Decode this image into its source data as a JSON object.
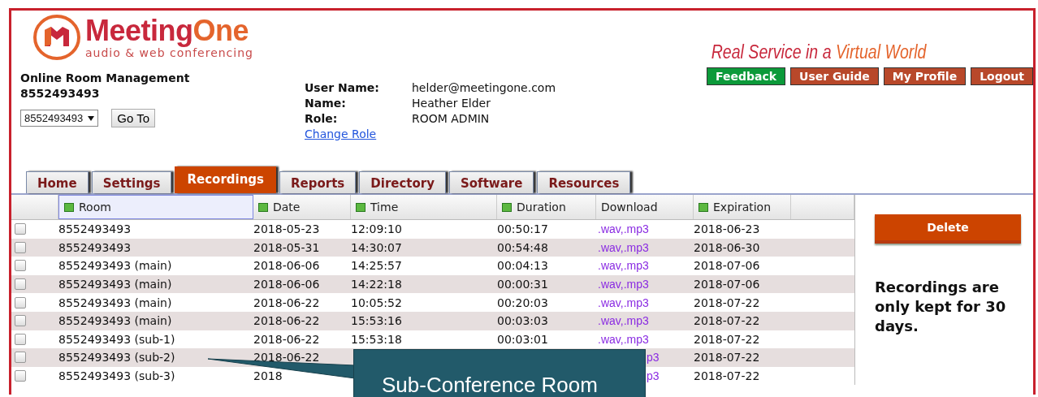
{
  "logo": {
    "word_1": "Meeting",
    "word_2": "One",
    "tagline": "audio & web conferencing"
  },
  "account": {
    "title": "Online Room Management",
    "number": "8552493493",
    "room_select": "8552493493",
    "go_button": "Go To"
  },
  "user": {
    "fields": [
      {
        "label": "User Name:",
        "value": "helder@meetingone.com"
      },
      {
        "label": "Name:",
        "value": "Heather Elder"
      },
      {
        "label": "Role:",
        "value": "ROOM ADMIN"
      }
    ],
    "change_role_link": "Change Role"
  },
  "slogan": {
    "part_1": "Real Service in a",
    "part_2": "Virtual World"
  },
  "top_buttons": [
    {
      "label": "Feedback",
      "color": "#0c9a3a"
    },
    {
      "label": "User Guide",
      "color": "#b8482a"
    },
    {
      "label": "My Profile",
      "color": "#b8482a"
    },
    {
      "label": "Logout",
      "color": "#b8482a"
    }
  ],
  "tabs": [
    {
      "label": "Home",
      "selected": false
    },
    {
      "label": "Settings",
      "selected": false
    },
    {
      "label": "Recordings",
      "selected": true
    },
    {
      "label": "Reports",
      "selected": false
    },
    {
      "label": "Directory",
      "selected": false
    },
    {
      "label": "Software",
      "selected": false
    },
    {
      "label": "Resources",
      "selected": false
    }
  ],
  "table": {
    "columns": [
      {
        "label": "Room",
        "sortable": true,
        "selected": true
      },
      {
        "label": "Date",
        "sortable": true,
        "selected": false
      },
      {
        "label": "Time",
        "sortable": true,
        "selected": false
      },
      {
        "label": "Duration",
        "sortable": true,
        "selected": false
      },
      {
        "label": "Download",
        "sortable": false,
        "selected": false
      },
      {
        "label": "Expiration",
        "sortable": true,
        "selected": false
      }
    ],
    "rows": [
      {
        "checked": false,
        "room": "8552493493",
        "date": "2018-05-23",
        "time": "12:09:10",
        "duration": "00:50:17",
        "download": ".wav,.mp3",
        "expiration": "2018-06-23"
      },
      {
        "checked": false,
        "room": "8552493493",
        "date": "2018-05-31",
        "time": "14:30:07",
        "duration": "00:54:48",
        "download": ".wav,.mp3",
        "expiration": "2018-06-30"
      },
      {
        "checked": false,
        "room": "8552493493 (main)",
        "date": "2018-06-06",
        "time": "14:25:57",
        "duration": "00:04:13",
        "download": ".wav,.mp3",
        "expiration": "2018-07-06"
      },
      {
        "checked": false,
        "room": "8552493493 (main)",
        "date": "2018-06-06",
        "time": "14:22:18",
        "duration": "00:00:31",
        "download": ".wav,.mp3",
        "expiration": "2018-07-06"
      },
      {
        "checked": false,
        "room": "8552493493 (main)",
        "date": "2018-06-22",
        "time": "10:05:52",
        "duration": "00:20:03",
        "download": ".wav,.mp3",
        "expiration": "2018-07-22"
      },
      {
        "checked": false,
        "room": "8552493493 (main)",
        "date": "2018-06-22",
        "time": "15:53:16",
        "duration": "00:03:03",
        "download": ".wav,.mp3",
        "expiration": "2018-07-22"
      },
      {
        "checked": false,
        "room": "8552493493 (sub-1)",
        "date": "2018-06-22",
        "time": "15:53:18",
        "duration": "00:03:01",
        "download": ".wav,.mp3",
        "expiration": "2018-07-22"
      },
      {
        "checked": false,
        "room": "8552493493 (sub-2)",
        "date": "2018-06-22",
        "download": "p3",
        "expiration": "2018-07-22"
      },
      {
        "checked": false,
        "room": "8552493493 (sub-3)",
        "date": "2018",
        "download": "p3",
        "expiration": "2018-07-22"
      }
    ]
  },
  "delete_button": "Delete",
  "retention_note": "Recordings are only kept for 30 days.",
  "callout": {
    "text": "Sub-Conference Room"
  }
}
